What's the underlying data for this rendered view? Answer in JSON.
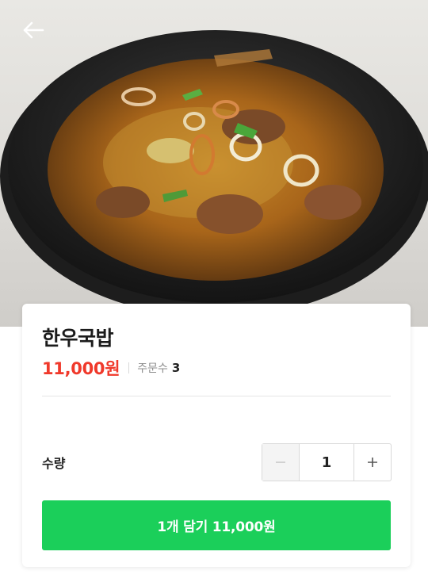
{
  "hero": {
    "image_alt": "hanwoo gukbap in black earthenware bowl",
    "back_icon": "arrow-left-icon"
  },
  "product": {
    "name": "한우국밥",
    "price": "11,000원",
    "orders_label": "주문수",
    "orders_count": "3"
  },
  "quantity": {
    "label": "수량",
    "value": "1",
    "minus_icon": "minus-icon",
    "plus_icon": "plus-icon"
  },
  "cta": {
    "label": "1개 담기 11,000원"
  },
  "colors": {
    "price": "#f0392b",
    "cta": "#1bcf5a",
    "title": "#1b1b1b"
  }
}
